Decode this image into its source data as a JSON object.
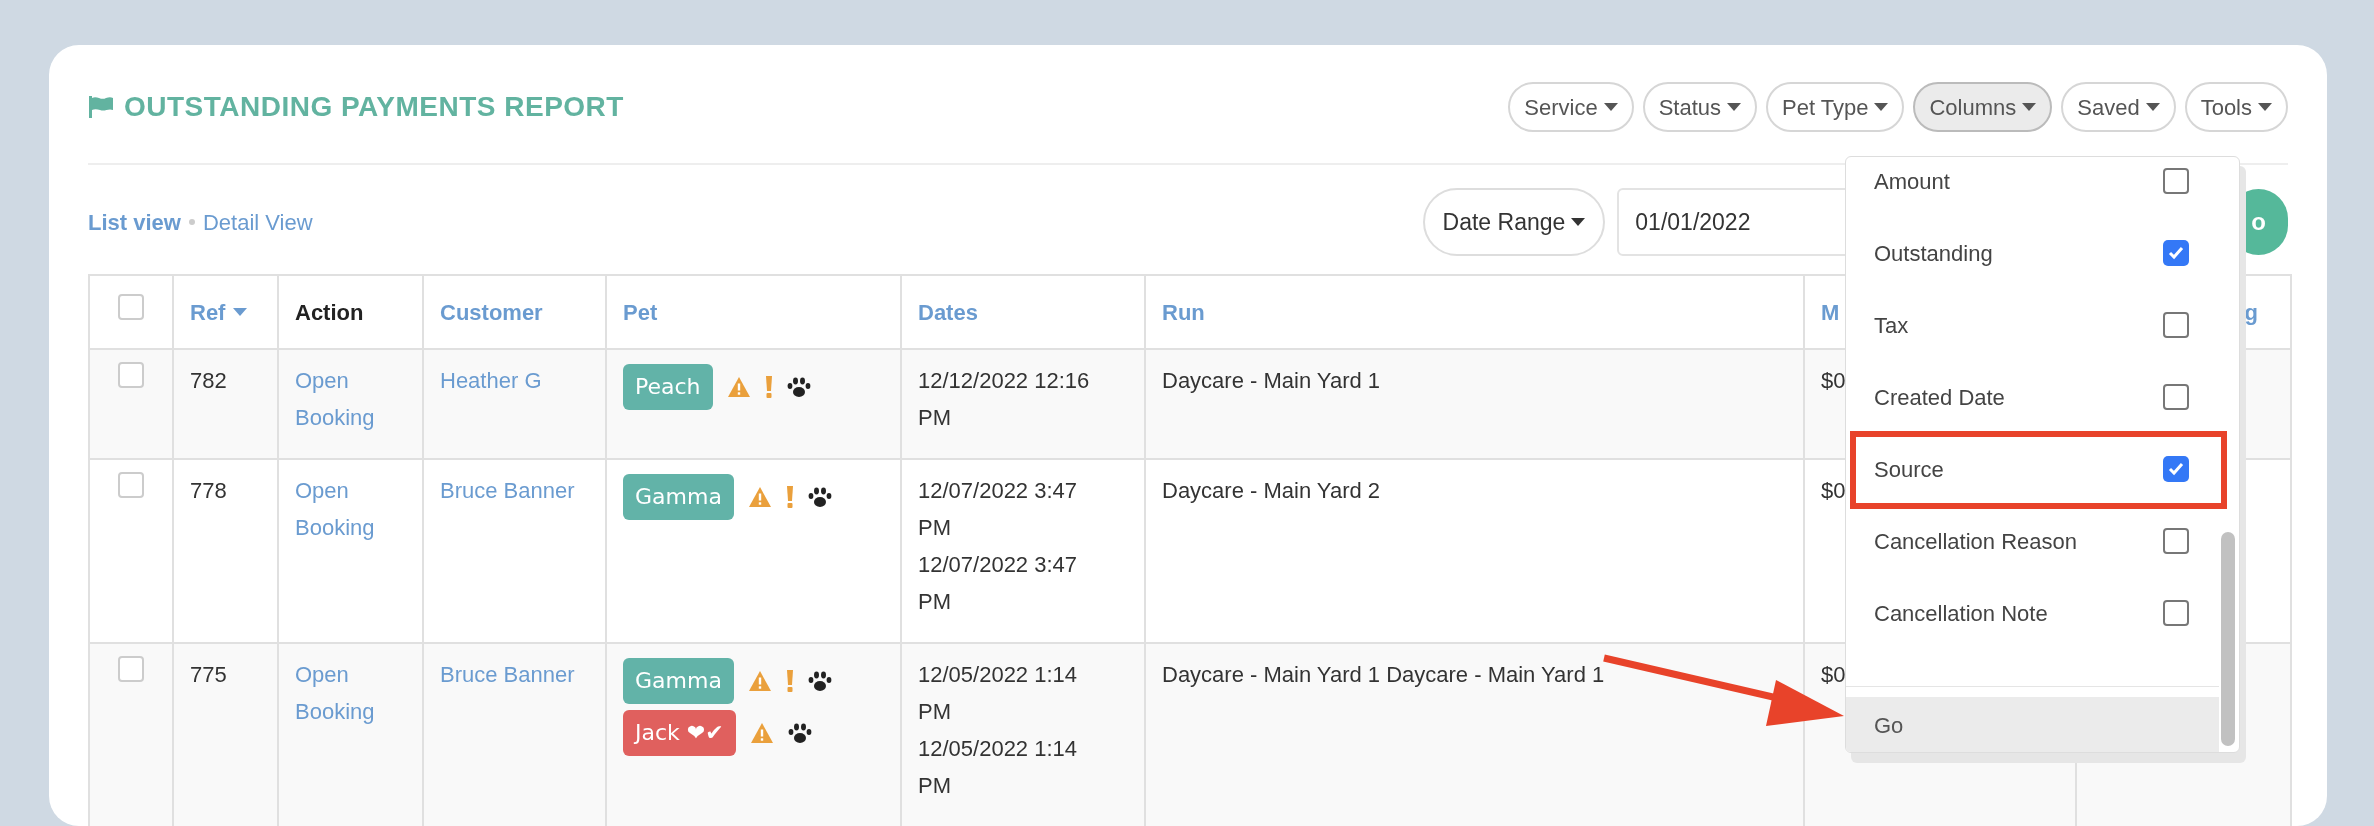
{
  "title": "OUTSTANDING PAYMENTS REPORT",
  "filters": [
    {
      "label": "Service",
      "active": false
    },
    {
      "label": "Status",
      "active": false
    },
    {
      "label": "Pet Type",
      "active": false
    },
    {
      "label": "Columns",
      "active": true
    },
    {
      "label": "Saved",
      "active": false
    },
    {
      "label": "Tools",
      "active": false
    }
  ],
  "views": [
    {
      "label": "List view",
      "selected": true
    },
    {
      "label": "Detail View",
      "selected": false
    }
  ],
  "date_range": {
    "label": "Date Range",
    "value": "01/01/2022",
    "go": "o"
  },
  "table": {
    "select_all": {
      "checked": false
    },
    "columns": [
      {
        "label": "Ref",
        "link": true,
        "sorted": true
      },
      {
        "label": "Action",
        "link": false,
        "sorted": false
      },
      {
        "label": "Customer",
        "link": true,
        "sorted": false
      },
      {
        "label": "Pet",
        "link": true,
        "sorted": false
      },
      {
        "label": "Dates",
        "link": true,
        "sorted": false
      },
      {
        "label": "Run",
        "link": true,
        "sorted": false
      },
      {
        "label": "M",
        "link": true,
        "sorted": false
      },
      {
        "label": "g",
        "link": true,
        "sorted": false
      }
    ],
    "rows": [
      {
        "checked": false,
        "ref": "782",
        "action": "Open Booking",
        "customer": "Heather G",
        "pets": [
          {
            "name": "Peach",
            "kind": "ok",
            "alert": true
          }
        ],
        "dates": [
          "12/12/2022 12:16 PM"
        ],
        "run": "Daycare - Main Yard 1",
        "column_7": "$0"
      },
      {
        "checked": false,
        "ref": "778",
        "action": "Open Booking",
        "customer": "Bruce Banner",
        "pets": [
          {
            "name": "Gamma",
            "kind": "ok",
            "alert": true
          }
        ],
        "dates": [
          "12/07/2022 3:47 PM",
          "12/07/2022 3:47 PM"
        ],
        "run": "Daycare - Main Yard 2",
        "column_7": "$0"
      },
      {
        "checked": false,
        "ref": "775",
        "action": "Open Booking",
        "customer": "Bruce Banner",
        "pets": [
          {
            "name": "Gamma",
            "kind": "ok",
            "alert": true
          },
          {
            "name": "Jack ❤✔",
            "kind": "flagged",
            "alert": false
          }
        ],
        "dates": [
          "12/05/2022 1:14 PM",
          "12/05/2022 1:14 PM"
        ],
        "run": "Daycare - Main Yard 1 Daycare - Main Yard 1",
        "column_7": "$0"
      }
    ]
  },
  "columns_menu": {
    "items": [
      {
        "label": "Amount",
        "checked": false,
        "highlighted": false
      },
      {
        "label": "Outstanding",
        "checked": true,
        "highlighted": false
      },
      {
        "label": "Tax",
        "checked": false,
        "highlighted": false
      },
      {
        "label": "Created Date",
        "checked": false,
        "highlighted": false
      },
      {
        "label": "Source",
        "checked": true,
        "highlighted": true
      },
      {
        "label": "Cancellation Reason",
        "checked": false,
        "highlighted": false
      },
      {
        "label": "Cancellation Note",
        "checked": false,
        "highlighted": false
      }
    ],
    "footer": {
      "label": "Go",
      "pointed_at": true
    }
  }
}
